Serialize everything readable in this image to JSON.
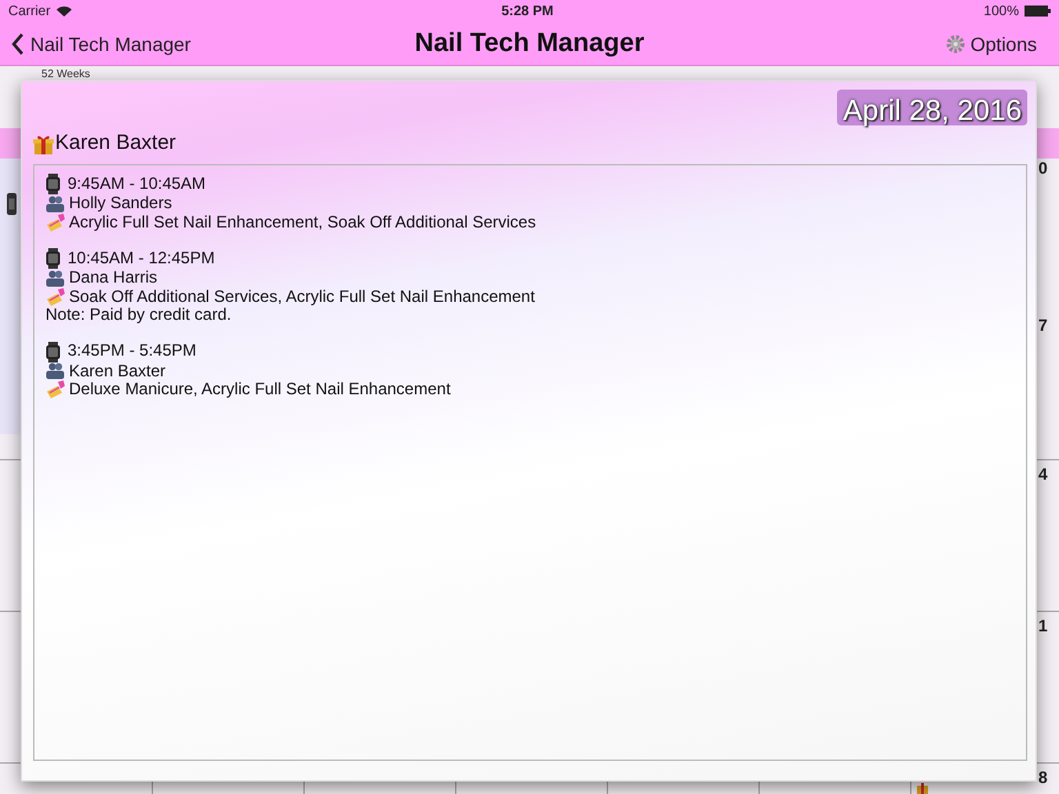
{
  "status_bar": {
    "carrier": "Carrier",
    "time": "5:28 PM",
    "battery": "100%"
  },
  "nav_bar": {
    "back": "Nail Tech Manager",
    "title": "Nail Tech Manager",
    "options": "Options"
  },
  "calendar": {
    "header": "52 Weeks",
    "day_numbers": [
      "0",
      "7",
      "4",
      "1",
      "8"
    ]
  },
  "popup": {
    "date": "April 28, 2016",
    "client": "Karen Baxter",
    "appointments": [
      {
        "time": "9:45AM - 10:45AM",
        "customer": "Holly Sanders",
        "services": "Acrylic Full Set Nail Enhancement, Soak Off Additional Services"
      },
      {
        "time": "10:45AM - 12:45PM",
        "customer": "Dana Harris",
        "services": "Soak Off Additional Services, Acrylic Full Set Nail Enhancement",
        "note": "Note: Paid by credit card."
      },
      {
        "time": "3:45PM - 5:45PM",
        "customer": "Karen Baxter",
        "services": "Deluxe Manicure, Acrylic Full Set Nail Enhancement"
      }
    ]
  }
}
